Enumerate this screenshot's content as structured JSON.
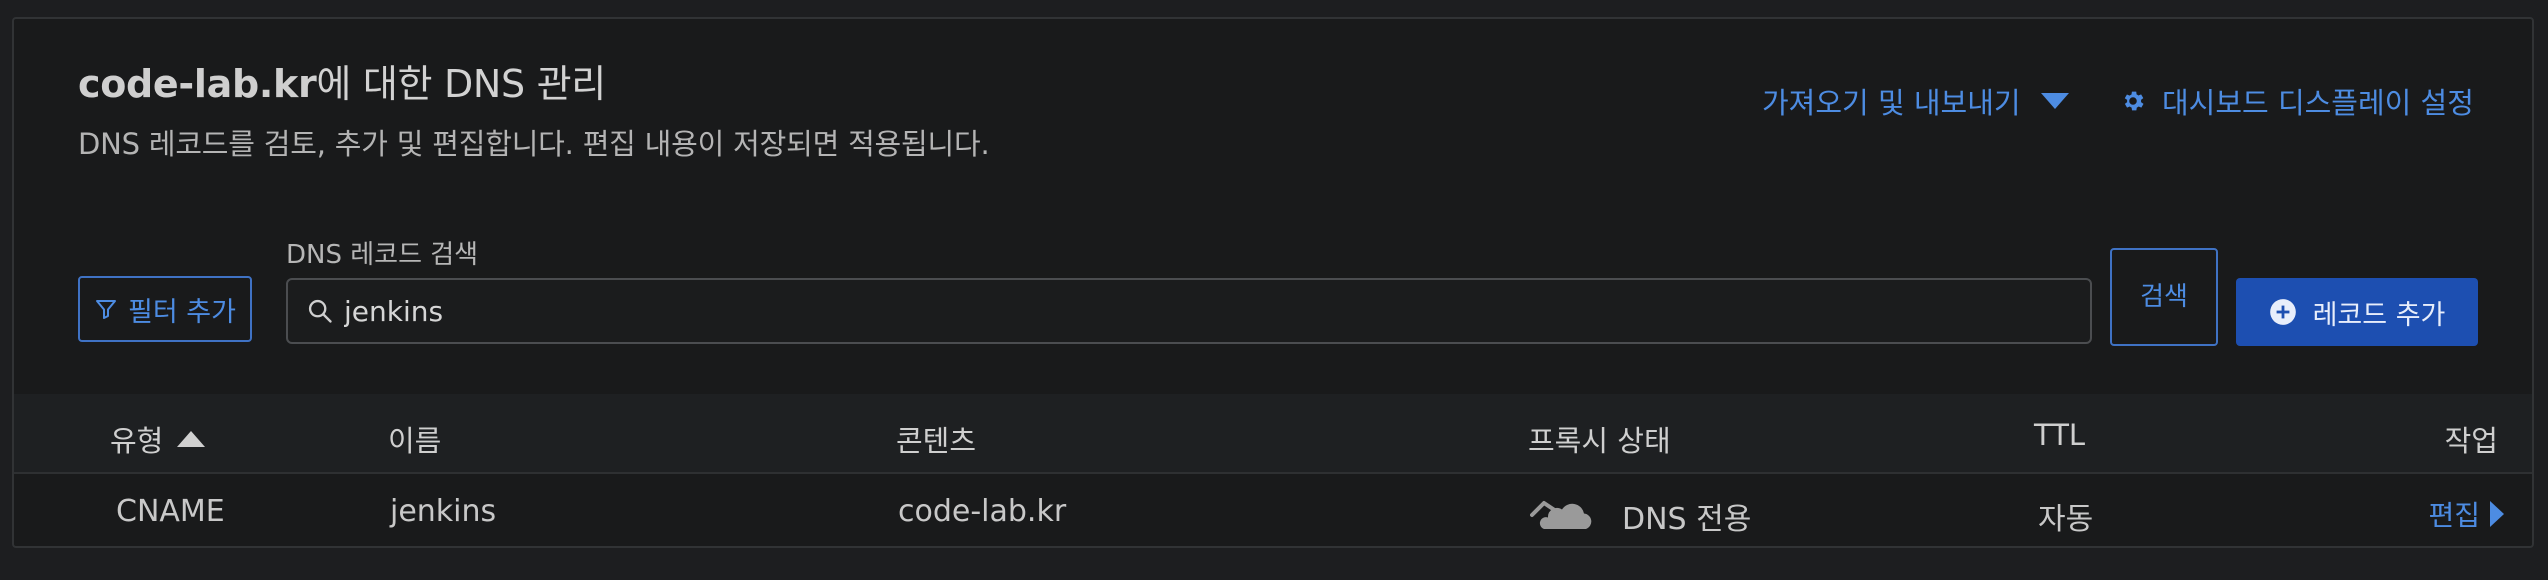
{
  "header": {
    "domain": "code-lab.kr",
    "title_suffix": "에 대한 DNS 관리",
    "subtitle": "DNS 레코드를 검토, 추가 및 편집합니다. 편집 내용이 저장되면 적용됩니다.",
    "import_export_label": "가져오기 및 내보내기",
    "dashboard_settings_label": "대시보드 디스플레이 설정"
  },
  "toolbar": {
    "filter_label": "필터 추가",
    "search_label": "DNS 레코드 검색",
    "search_value": "jenkins",
    "search_button_label": "검색",
    "add_record_label": "레코드 추가"
  },
  "table": {
    "columns": {
      "type": "유형",
      "name": "이름",
      "content": "콘텐츠",
      "proxy": "프록시 상태",
      "ttl": "TTL",
      "action": "작업"
    },
    "rows": [
      {
        "type": "CNAME",
        "name": "jenkins",
        "content": "code-lab.kr",
        "proxy": "DNS 전용",
        "ttl": "자동",
        "action": "편집"
      }
    ]
  },
  "colors": {
    "accent": "#4d8ce2",
    "primary_button": "#1d4fb1",
    "background": "#191a1b"
  },
  "icons": [
    "chevron-down-icon",
    "gear-icon",
    "filter-icon",
    "search-icon",
    "plus-circle-icon",
    "sort-ascending-icon",
    "cloud-icon",
    "chevron-right-icon"
  ]
}
